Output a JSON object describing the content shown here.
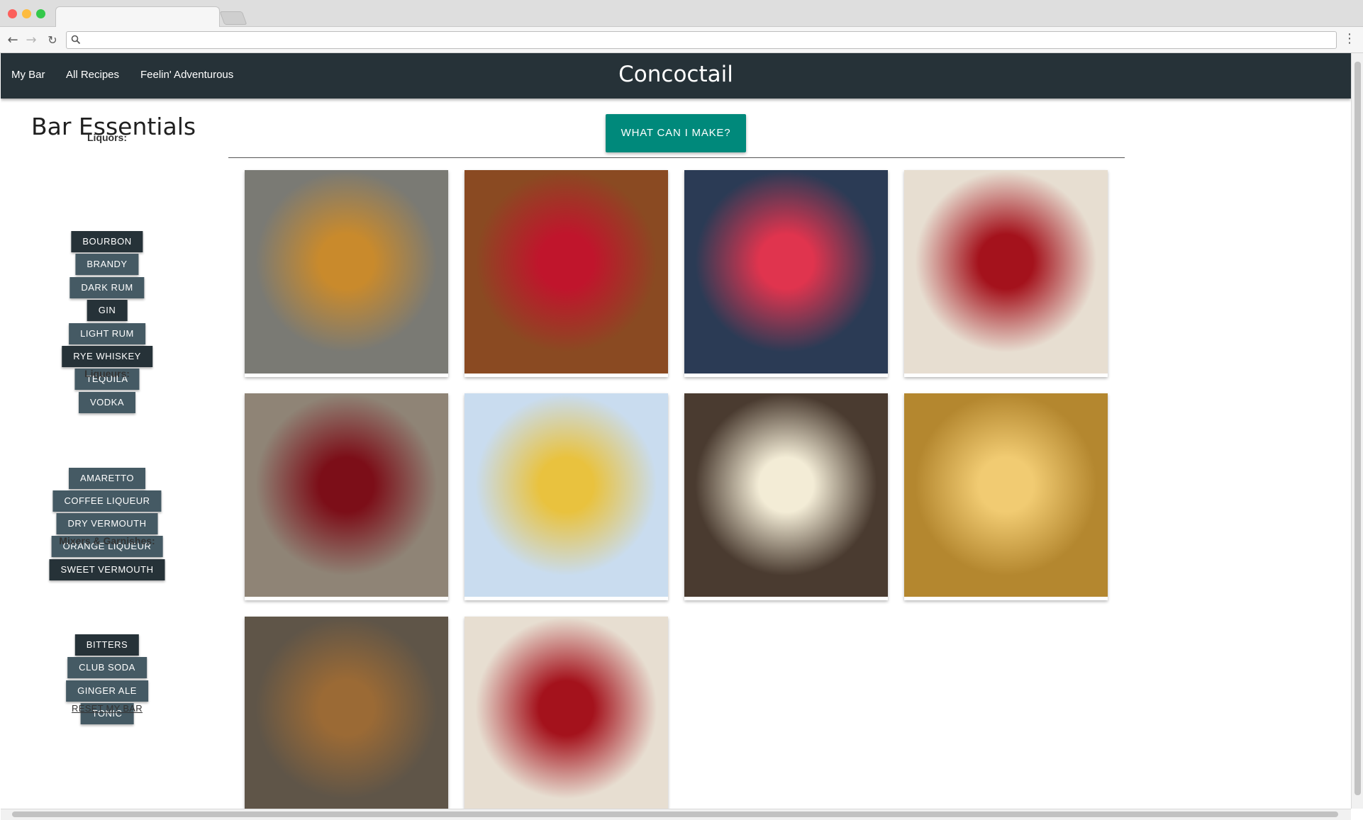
{
  "nav": {
    "links": [
      "My Bar",
      "All Recipes",
      "Feelin' Adventurous"
    ],
    "brand": "Concoctail"
  },
  "sidebar": {
    "title": "Bar Essentials",
    "groups": [
      {
        "label": "Liquors:",
        "items": [
          {
            "label": "BOURBON",
            "selected": true
          },
          {
            "label": "BRANDY",
            "selected": false
          },
          {
            "label": "DARK RUM",
            "selected": false
          },
          {
            "label": "GIN",
            "selected": true
          },
          {
            "label": "LIGHT RUM",
            "selected": false
          },
          {
            "label": "RYE WHISKEY",
            "selected": true
          },
          {
            "label": "TEQUILA",
            "selected": false
          },
          {
            "label": "VODKA",
            "selected": false
          }
        ]
      },
      {
        "label": "Liqueurs:",
        "items": [
          {
            "label": "AMARETTO",
            "selected": false
          },
          {
            "label": "COFFEE LIQUEUR",
            "selected": false
          },
          {
            "label": "DRY VERMOUTH",
            "selected": false
          },
          {
            "label": "ORANGE LIQUEUR",
            "selected": false
          },
          {
            "label": "SWEET VERMOUTH",
            "selected": true
          }
        ]
      },
      {
        "label": "Mixers & Garnishes:",
        "items": [
          {
            "label": "BITTERS",
            "selected": true
          },
          {
            "label": "CLUB SODA",
            "selected": false
          },
          {
            "label": "GINGER ALE",
            "selected": false
          },
          {
            "label": "TONIC",
            "selected": false
          }
        ]
      }
    ],
    "reset_label": "RESET MY BAR"
  },
  "main": {
    "cta_label": "WHAT CAN I MAKE?",
    "recipes": [
      {
        "image": "manhattan-on-wooden-table",
        "colors": [
          "#7a7a74",
          "#c98a2c"
        ]
      },
      {
        "image": "negroni-rocks-glass-orange",
        "colors": [
          "#8a4a22",
          "#c0152c"
        ]
      },
      {
        "image": "pink-cocktails-with-bottles",
        "colors": [
          "#2b3b55",
          "#e0344e"
        ]
      },
      {
        "image": "red-martini-lemon-twist",
        "colors": [
          "#e7ded1",
          "#a4121c"
        ]
      },
      {
        "image": "boulevardier-with-cherry",
        "colors": [
          "#8f8476",
          "#7c0e18"
        ]
      },
      {
        "image": "lemon-highball-with-straw",
        "colors": [
          "#c9dcef",
          "#e9c23e"
        ]
      },
      {
        "image": "root-beer-float",
        "colors": [
          "#4a3b30",
          "#f3ecd6"
        ]
      },
      {
        "image": "champagne-flute-gold",
        "colors": [
          "#b4872f",
          "#f1cb72"
        ]
      },
      {
        "image": "old-fashioned-outdoors",
        "colors": [
          "#5f5548",
          "#9b6a35"
        ]
      },
      {
        "image": "red-martini-lemon-twist",
        "colors": [
          "#e7ded1",
          "#a4121c"
        ]
      }
    ]
  }
}
